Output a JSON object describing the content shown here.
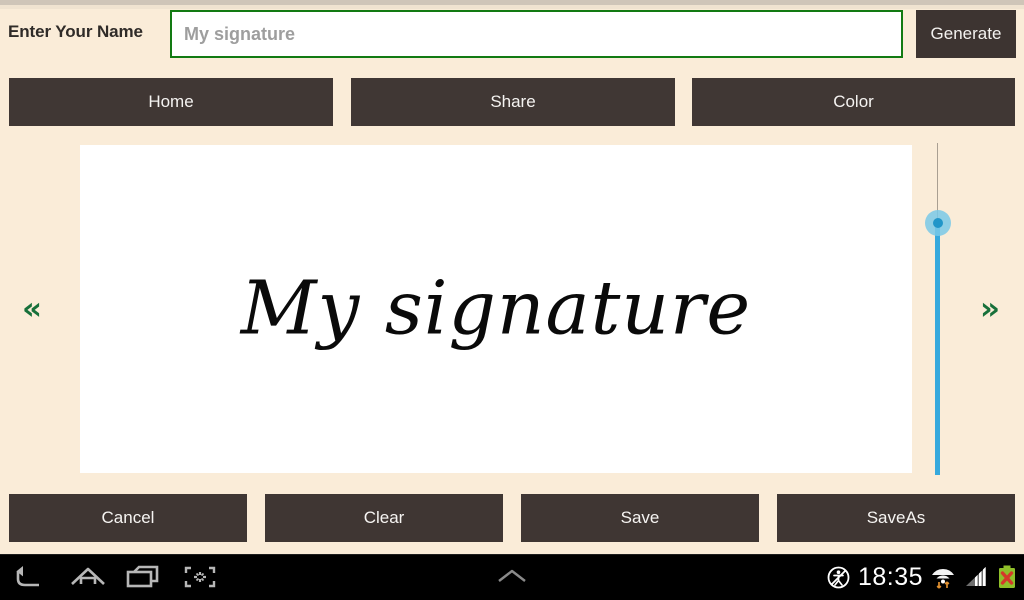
{
  "app": {
    "background_color": "#faecd8",
    "button_color": "#3f3633",
    "accent_green": "#127a12",
    "slider_color": "#36a9dd"
  },
  "header": {
    "label": "Enter Your Name",
    "input_value": "My signature",
    "input_placeholder": "My signature",
    "generate_label": "Generate"
  },
  "nav": {
    "home_label": "Home",
    "share_label": "Share",
    "color_label": "Color"
  },
  "stage": {
    "signature_text": "My signature",
    "prev_arrow": "«",
    "next_arrow": "»",
    "slider": {
      "name": "size-slider",
      "orientation": "vertical",
      "thumb_position_percent": 24
    }
  },
  "actions": {
    "cancel_label": "Cancel",
    "clear_label": "Clear",
    "save_label": "Save",
    "saveas_label": "SaveAs"
  },
  "system_bar": {
    "clock": "18:35",
    "icons": [
      "back-icon",
      "home-icon",
      "recent-apps-icon",
      "screenshot-icon",
      "expand-up-icon",
      "mute-icon",
      "wifi-icon",
      "signal-icon",
      "battery-error-icon"
    ]
  }
}
